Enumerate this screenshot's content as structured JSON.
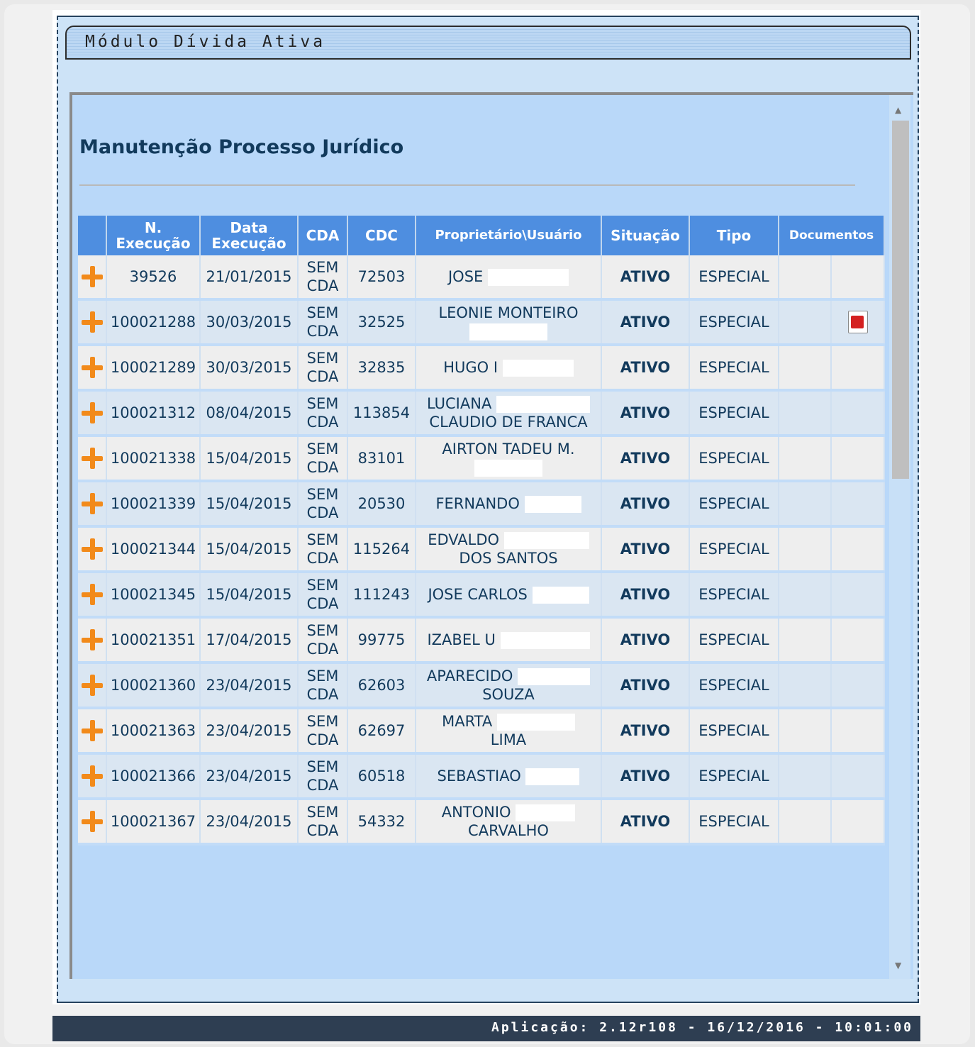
{
  "module": {
    "title": "Módulo Dívida Ativa"
  },
  "page": {
    "title": "Manutenção Processo Jurídico"
  },
  "table": {
    "headers": {
      "n_exec_l1": "N.",
      "n_exec_l2": "Execução",
      "data_exec_l1": "Data",
      "data_exec_l2": "Execução",
      "cda": "CDA",
      "cdc": "CDC",
      "owner": "Proprietário\\Usuário",
      "situacao": "Situação",
      "tipo": "Tipo",
      "documentos": "Documentos"
    },
    "rows": [
      {
        "num": "39526",
        "date": "21/01/2015",
        "cda1": "SEM",
        "cda2": "CDA",
        "cdc": "72503",
        "owner1": "JOSE",
        "owner2": "",
        "sit": "ATIVO",
        "tipo": "ESPECIAL",
        "doc": ""
      },
      {
        "num": "100021288",
        "date": "30/03/2015",
        "cda1": "SEM",
        "cda2": "CDA",
        "cdc": "32525",
        "owner1": "LEONIE MONTEIRO",
        "owner2": "",
        "sit": "ATIVO",
        "tipo": "ESPECIAL",
        "doc": "pdf-icon"
      },
      {
        "num": "100021289",
        "date": "30/03/2015",
        "cda1": "SEM",
        "cda2": "CDA",
        "cdc": "32835",
        "owner1": "HUGO I",
        "owner2": "",
        "sit": "ATIVO",
        "tipo": "ESPECIAL",
        "doc": ""
      },
      {
        "num": "100021312",
        "date": "08/04/2015",
        "cda1": "SEM",
        "cda2": "CDA",
        "cdc": "113854",
        "owner1": "LUCIANA",
        "owner2": "CLAUDIO DE FRANCA",
        "sit": "ATIVO",
        "tipo": "ESPECIAL",
        "doc": ""
      },
      {
        "num": "100021338",
        "date": "15/04/2015",
        "cda1": "SEM",
        "cda2": "CDA",
        "cdc": "83101",
        "owner1": "AIRTON TADEU M.",
        "owner2": "",
        "sit": "ATIVO",
        "tipo": "ESPECIAL",
        "doc": ""
      },
      {
        "num": "100021339",
        "date": "15/04/2015",
        "cda1": "SEM",
        "cda2": "CDA",
        "cdc": "20530",
        "owner1": "FERNANDO",
        "owner2": "",
        "sit": "ATIVO",
        "tipo": "ESPECIAL",
        "doc": ""
      },
      {
        "num": "100021344",
        "date": "15/04/2015",
        "cda1": "SEM",
        "cda2": "CDA",
        "cdc": "115264",
        "owner1": "EDVALDO",
        "owner2": "DOS SANTOS",
        "sit": "ATIVO",
        "tipo": "ESPECIAL",
        "doc": ""
      },
      {
        "num": "100021345",
        "date": "15/04/2015",
        "cda1": "SEM",
        "cda2": "CDA",
        "cdc": "111243",
        "owner1": "JOSE CARLOS",
        "owner2": "",
        "sit": "ATIVO",
        "tipo": "ESPECIAL",
        "doc": ""
      },
      {
        "num": "100021351",
        "date": "17/04/2015",
        "cda1": "SEM",
        "cda2": "CDA",
        "cdc": "99775",
        "owner1": "IZABEL U",
        "owner2": "",
        "sit": "ATIVO",
        "tipo": "ESPECIAL",
        "doc": ""
      },
      {
        "num": "100021360",
        "date": "23/04/2015",
        "cda1": "SEM",
        "cda2": "CDA",
        "cdc": "62603",
        "owner1": "APARECIDO",
        "owner2": "SOUZA",
        "sit": "ATIVO",
        "tipo": "ESPECIAL",
        "doc": ""
      },
      {
        "num": "100021363",
        "date": "23/04/2015",
        "cda1": "SEM",
        "cda2": "CDA",
        "cdc": "62697",
        "owner1": "MARTA",
        "owner2": "LIMA",
        "sit": "ATIVO",
        "tipo": "ESPECIAL",
        "doc": ""
      },
      {
        "num": "100021366",
        "date": "23/04/2015",
        "cda1": "SEM",
        "cda2": "CDA",
        "cdc": "60518",
        "owner1": "SEBASTIAO",
        "owner2": "",
        "sit": "ATIVO",
        "tipo": "ESPECIAL",
        "doc": ""
      },
      {
        "num": "100021367",
        "date": "23/04/2015",
        "cda1": "SEM",
        "cda2": "CDA",
        "cdc": "54332",
        "owner1": "ANTONIO",
        "owner2": "CARVALHO",
        "sit": "ATIVO",
        "tipo": "ESPECIAL",
        "doc": ""
      }
    ]
  },
  "footer": {
    "text": "Aplicação: 2.12r108 - 16/12/2016 - 10:01:00"
  },
  "colors": {
    "header_bg": "#4e8ee0",
    "plus": "#f28a1a",
    "footer_bg": "#2e3e52",
    "panel_bg": "#b9d8f9"
  },
  "icons": {
    "row_expand": "plus-icon",
    "document": "pdf-icon",
    "scroll_up": "arrow-up-icon",
    "scroll_down": "arrow-down-icon"
  }
}
